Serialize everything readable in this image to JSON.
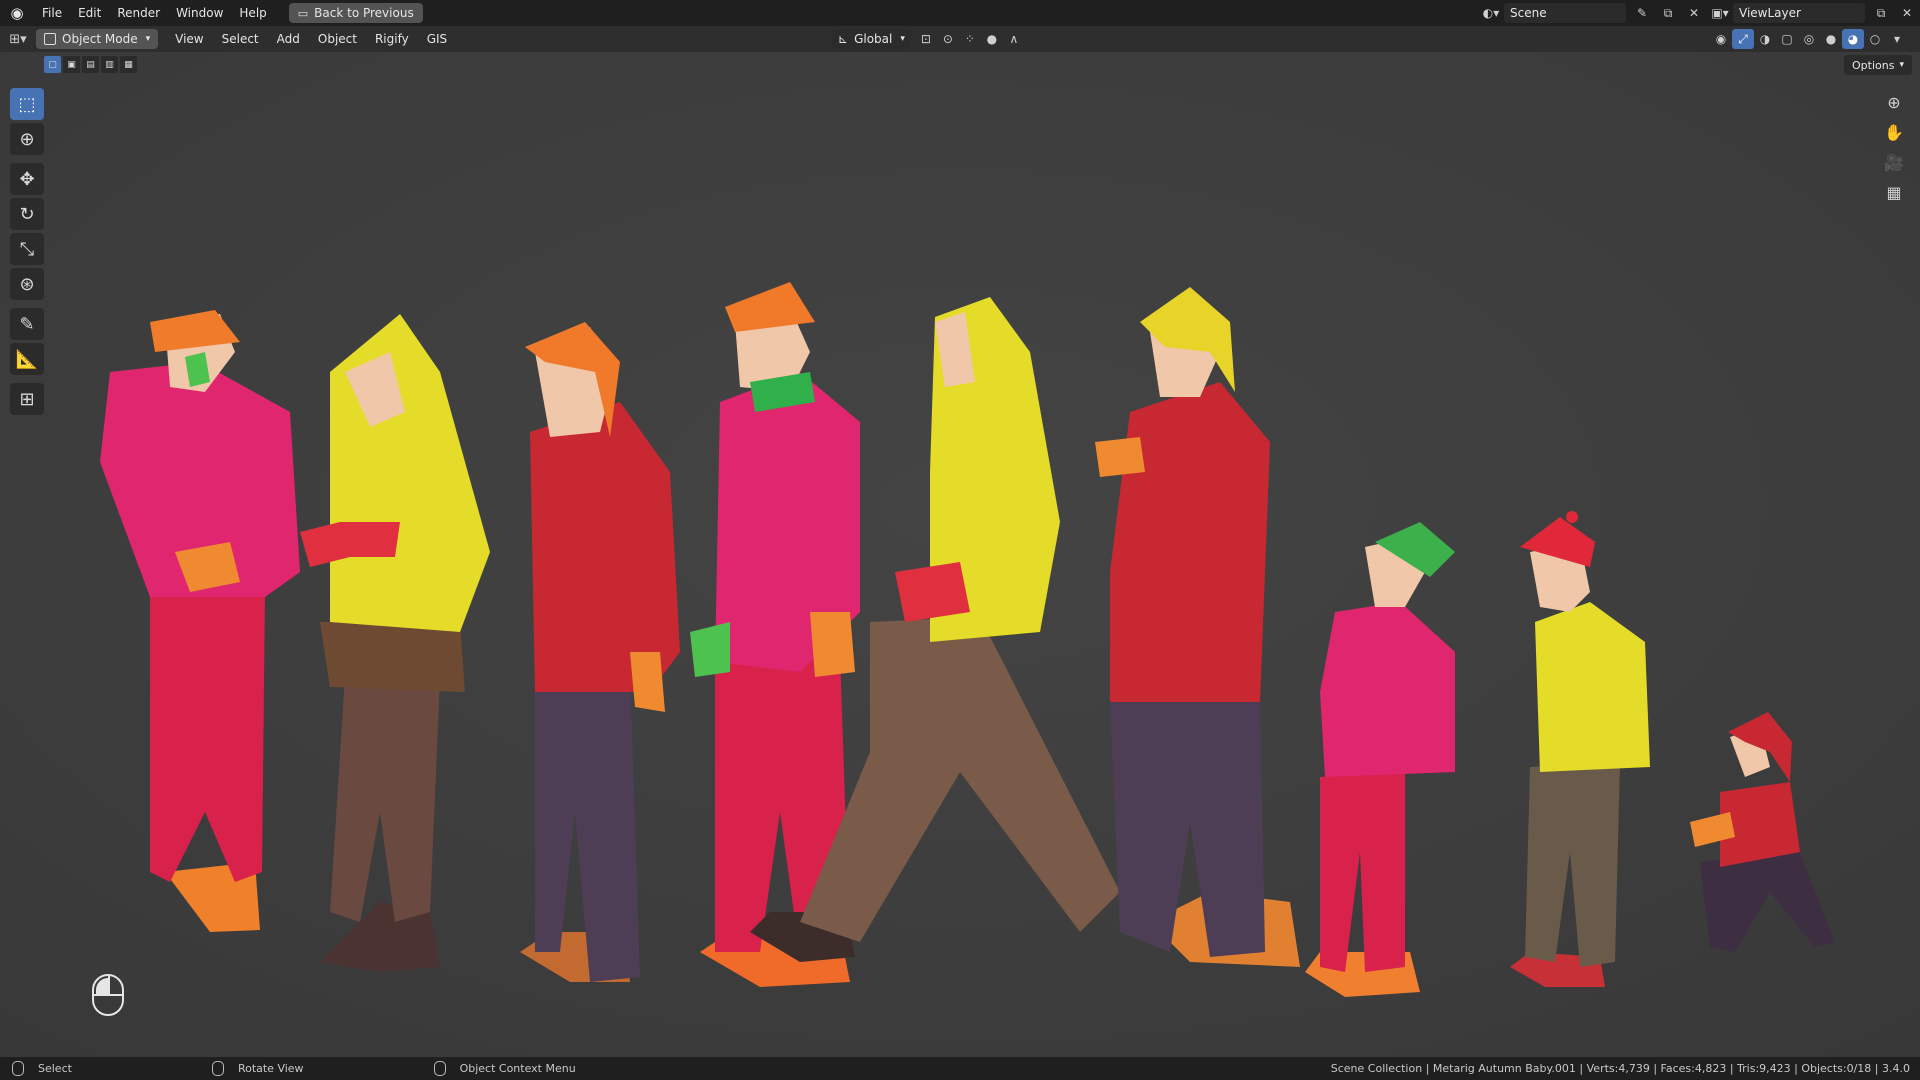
{
  "topbar": {
    "menu": [
      "File",
      "Edit",
      "Render",
      "Window",
      "Help"
    ],
    "back_button": "Back to Previous",
    "scene": "Scene",
    "view_layer": "ViewLayer"
  },
  "header": {
    "mode": "Object Mode",
    "menu": [
      "View",
      "Select",
      "Add",
      "Object",
      "Rigify",
      "GIS"
    ],
    "orientation": "Global",
    "options": "Options"
  },
  "tools": [
    "select-box",
    "cursor",
    "move",
    "rotate",
    "scale",
    "transform",
    "annotate",
    "measure",
    "add-cube"
  ],
  "status": {
    "left_action": "Select",
    "middle_action": "Rotate View",
    "right_action": "Object Context Menu",
    "stats": "Scene Collection | Metarig Autumn Baby.001 | Verts:4,739 | Faces:4,823 | Tris:9,423 | Objects:0/18 | 3.4.0"
  },
  "colors": {
    "accent": "#4772b3",
    "viewport_bg": "#3d3d3d",
    "header_bg": "#2e2e2e",
    "topbar_bg": "#1f1f1f"
  }
}
